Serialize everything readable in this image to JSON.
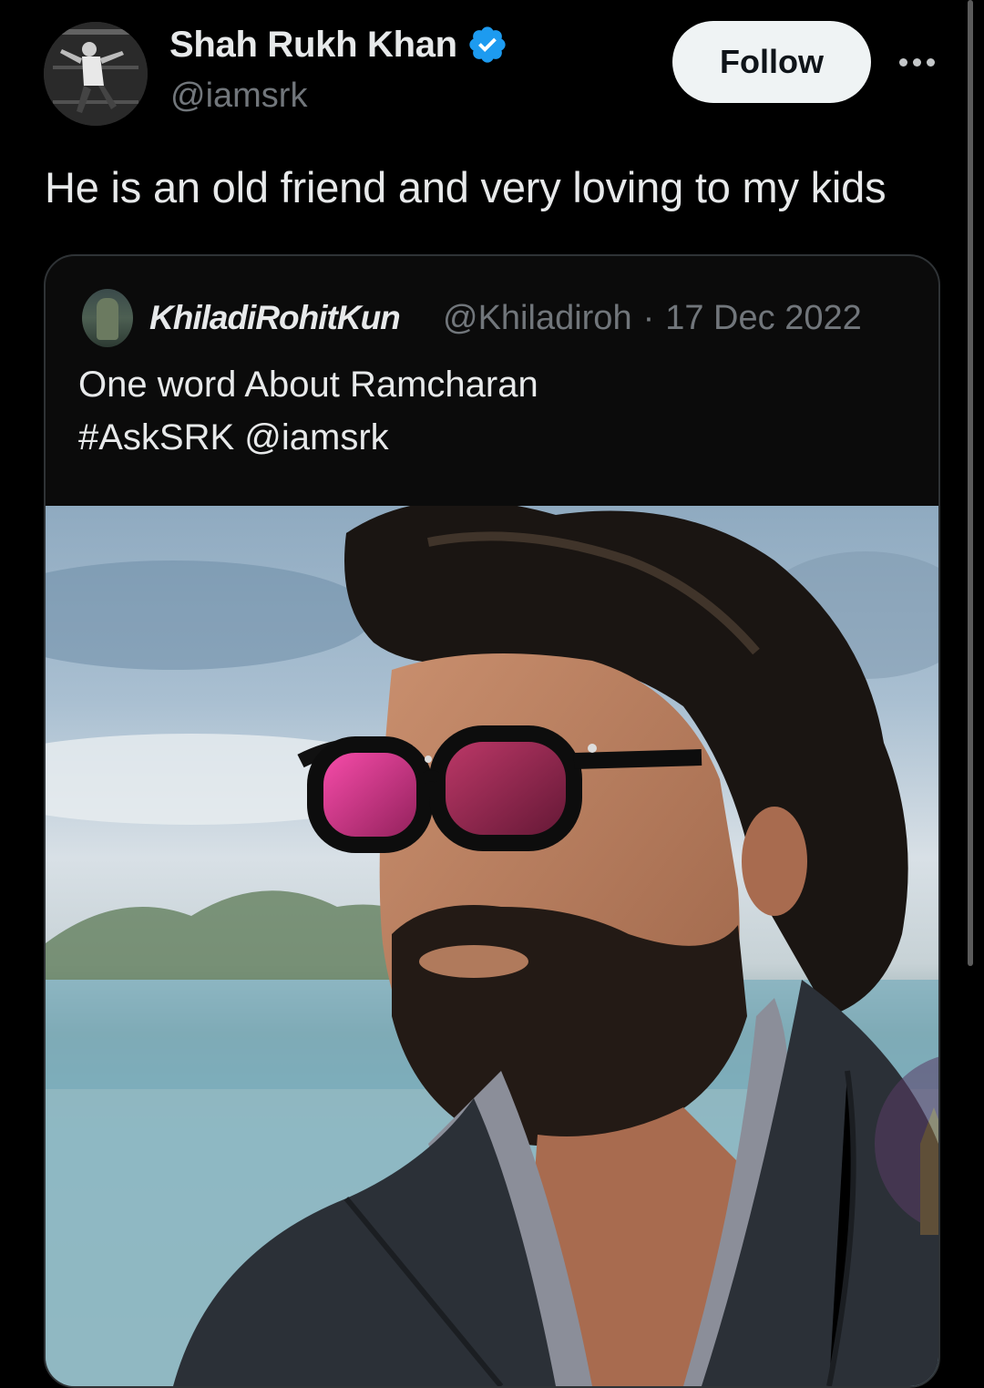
{
  "tweet": {
    "author": {
      "display_name": "Shah Rukh Khan",
      "handle": "@iamsrk",
      "verified": true
    },
    "follow_label": "Follow",
    "more_icon": "more-horizontal-icon",
    "text": "He is an old friend and very loving to my kids"
  },
  "quoted_tweet": {
    "display_name": "KhiladiRohitKun",
    "handle": "@Khiladiroh",
    "separator": "·",
    "date": "17 Dec 2022",
    "text_lines": [
      "One word About Ramcharan",
      "#AskSRK @iamsrk"
    ]
  },
  "colors": {
    "background": "#000000",
    "text_primary": "#e7e9ea",
    "text_secondary": "#71767b",
    "verified_blue": "#1d9bf0",
    "follow_bg": "#eff3f4",
    "card_border": "#2f3336"
  }
}
